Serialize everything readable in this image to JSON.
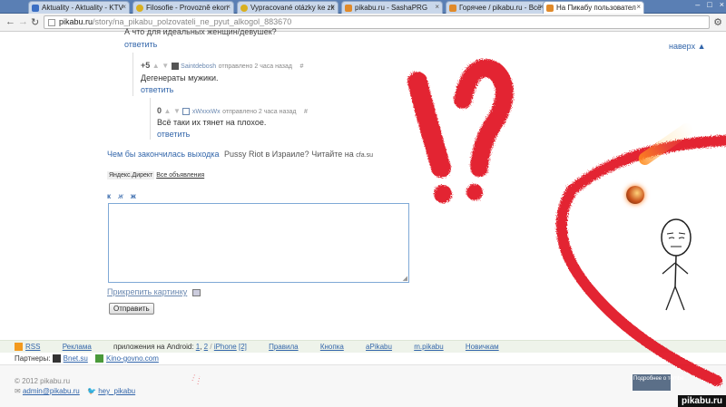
{
  "browser": {
    "tabs": [
      {
        "label": "Aktuality - Aktuality - KTV",
        "icon": "blue-square-icon",
        "color": "#3b6fc4"
      },
      {
        "label": "Filosofie - Provozně ekon",
        "icon": "moon-icon",
        "color": "#d9b020"
      },
      {
        "label": "Vypracované otázky ke zk",
        "icon": "moon-icon",
        "color": "#d9b020"
      },
      {
        "label": "pikabu.ru - SashaPRG",
        "icon": "pikabu-icon",
        "color": "#e08a2a"
      },
      {
        "label": "Горячее / pikabu.ru - Всё",
        "icon": "pikabu-icon",
        "color": "#e08a2a"
      },
      {
        "label": "На Пикабу пользовател",
        "icon": "pikabu-icon",
        "color": "#e08a2a"
      }
    ],
    "url_domain": "pikabu.ru",
    "url_path": "/story/na_pikabu_polzovateli_ne_pyut_alkogol_883670"
  },
  "comments": {
    "top_cut": "А что для идеальных женщин/девушек?",
    "top_reply": "ответить",
    "up_link": "наверх",
    "c1": {
      "vote": "+5",
      "user": "Saintdebosh",
      "meta": "отправлено 2 часа назад",
      "hash": "#",
      "text": "Дегенераты мужики.",
      "reply": "ответить"
    },
    "c2": {
      "vote": "0",
      "user": "xWxxxWx",
      "meta": "отправлено 2 часа назад",
      "hash": "#",
      "text": "Всё таки их тянет на плохое.",
      "reply": "ответить"
    }
  },
  "ad": {
    "headline": "Чем бы закончилась выходка",
    "body": "Pussy Riot в Израиле? Читайте на",
    "domain": "cfa.su",
    "direct": "Яндекс.Директ",
    "all_ads": "Все объявления"
  },
  "form": {
    "fmt_b": "к",
    "fmt_i": "ж",
    "fmt_c": "ж",
    "attach": "Прикрепить картинку",
    "submit": "Отправить"
  },
  "footer": {
    "links": [
      "RSS",
      "Реклама"
    ],
    "android_label": "приложения на Android:",
    "android_1": "1",
    "android_2": "2",
    "iphone": "iPhone",
    "iphone_n": "[2]",
    "rules": "Правила",
    "button": "Кнопка",
    "apikabu": "aPikabu",
    "mpikabu": "m.pikabu",
    "newbies": "Новичкам",
    "partners_label": "Партнеры:",
    "partner1": "Bnet.su",
    "partner2": "Kino-govno.com",
    "copyright": "© 2012 pikabu.ru",
    "admin_mail": "admin@pikabu.ru",
    "twitter": "hey_pikabu",
    "tumblr": "Подробнее о тоmbе"
  },
  "watermark": "pikabu.ru",
  "colors": {
    "scribble_red": "#e0101a",
    "link": "#3366aa"
  }
}
